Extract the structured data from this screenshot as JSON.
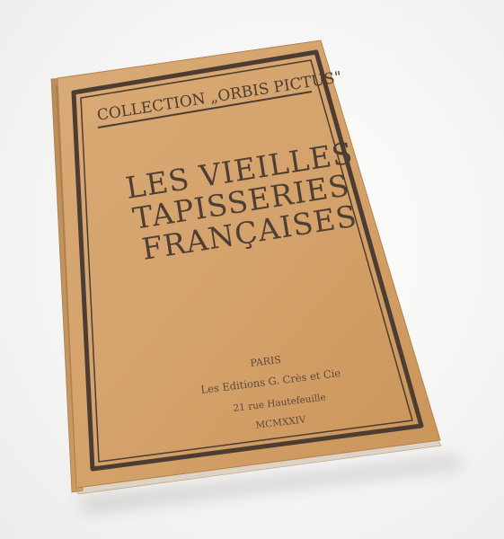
{
  "cover": {
    "collection_label": "COLLECTION „ORBIS PICTUS\"",
    "title_lines": [
      "LES VIEILLES",
      "TAPISSERIES",
      "FRANÇAISES"
    ],
    "imprint": {
      "city": "PARIS",
      "publisher": "Les Editions G. Crès et Cie",
      "address": "21 rue Hautefeuille",
      "year": "MCMXXIV"
    }
  },
  "colors": {
    "cover": "#d6a36d",
    "border": "#4c3c31",
    "background": "#f7f7f6"
  }
}
